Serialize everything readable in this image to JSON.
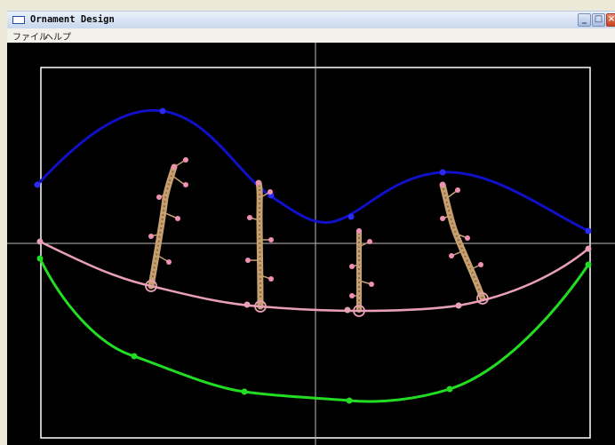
{
  "window": {
    "title": "Ornament Design"
  },
  "menu": {
    "items": [
      "ファイル",
      "ヘルプ"
    ]
  },
  "window_buttons": {
    "minimize": "_",
    "maximize": "□",
    "close": "×"
  },
  "colors": {
    "canvas_background": "#000000",
    "frame": "#ffffff",
    "axes": "#bdbdbd",
    "curve_upper": "#1010c8",
    "curve_middle": "#e8a0b4",
    "curve_lower": "#22dd22",
    "branch": "#c8a070",
    "bud": "#f090b4"
  },
  "curves": [
    "curve-upper",
    "curve-middle",
    "curve-lower"
  ],
  "ornaments": {
    "count": 4,
    "shape": "branch-with-buds"
  }
}
